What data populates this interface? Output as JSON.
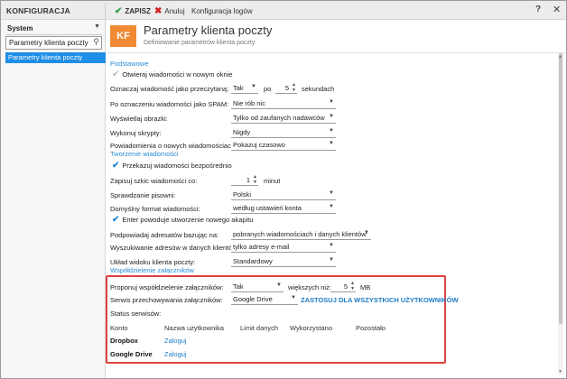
{
  "app": {
    "title": "KONFIGURACJA"
  },
  "toolbar": {
    "save_label": "ZAPISZ",
    "cancel_label": "Anuluj",
    "logs_label": "Konfiguracja logów",
    "help": "?",
    "close": "✕"
  },
  "icons": {
    "save": "check-icon",
    "cancel": "x-icon",
    "search": "search-icon",
    "chevron": "chevron-down-icon"
  },
  "sidebar": {
    "selector_value": "System",
    "search_value": "Parametry klienta poczty",
    "items": [
      {
        "label": "Parametry klienta poczty",
        "selected": true
      }
    ]
  },
  "header": {
    "logo": "KF",
    "title": "Parametry klienta poczty",
    "subtitle": "Definiowanie parametrów klienta poczty"
  },
  "sections": {
    "basic": {
      "title": "Podstawowe",
      "open_new_window": {
        "label": "Otwieraj wiadomości w nowym oknie",
        "checked": false
      },
      "mark_read": {
        "label": "Oznaczaj wiadomość jako przeczytaną:",
        "value": "Tak",
        "after_label": "po",
        "seconds": "5",
        "unit": "sekundach"
      },
      "after_spam": {
        "label": "Po oznaczeniu wiadomości jako SPAM:",
        "value": "Nie rób nic"
      },
      "show_images": {
        "label": "Wyświetlaj obrazki:",
        "value": "Tylko od zaufanych nadawców"
      },
      "run_scripts": {
        "label": "Wykonuj skrypty:",
        "value": "Nigdy"
      },
      "notifications": {
        "label": "Powiadomienia o nowych wiadomościach:",
        "value": "Pokazuj czasowo"
      }
    },
    "compose": {
      "title": "Tworzenie wiadomości",
      "forward_direct": {
        "label": "Przekazuj wiadomości bezpośrednio",
        "checked": true
      },
      "save_draft": {
        "label": "Zapisuj szkic wiadomości co:",
        "value": "1",
        "unit": "minut"
      },
      "spellcheck": {
        "label": "Sprawdzanie pisowni:",
        "value": "Polski"
      },
      "default_format": {
        "label": "Domyślny format wiadomości:",
        "value": "według ustawień konta"
      },
      "enter_paragraph": {
        "label": "Enter powoduje utworzenie nowego akapitu",
        "checked": true
      },
      "suggest_addresses": {
        "label": "Podpowiadaj adresatów bazując na:",
        "value": "pobranych wiadomościach i danych klientów"
      },
      "address_search": {
        "label": "Wyszukiwanie adresów w danych klientów:",
        "value": "tylko adresy e-mail"
      },
      "client_layout": {
        "label": "Układ widoku klienta poczty:",
        "value": "Standardowy"
      }
    },
    "sharing": {
      "title": "Współdzielenie załączników",
      "propose": {
        "label": "Proponuj współdzielenie załączników:",
        "value": "Tak",
        "larger_label": "większych niż:",
        "size": "5",
        "unit": "MB"
      },
      "storage": {
        "label": "Serwis przechowywania załączników:",
        "value": "Google Drive",
        "apply_label": "ZASTOSUJ DLA WSZYSTKICH UŻYTKOWNIKÓW"
      },
      "status_label": "Status serwisów:",
      "columns": [
        "Konto",
        "Nazwa użytkownika",
        "Limit danych",
        "Wykorzystano",
        "Pozostało"
      ],
      "services": [
        {
          "name": "Dropbox",
          "action": "Zaloguj"
        },
        {
          "name": "Google Drive",
          "action": "Zaloguj"
        }
      ]
    }
  }
}
